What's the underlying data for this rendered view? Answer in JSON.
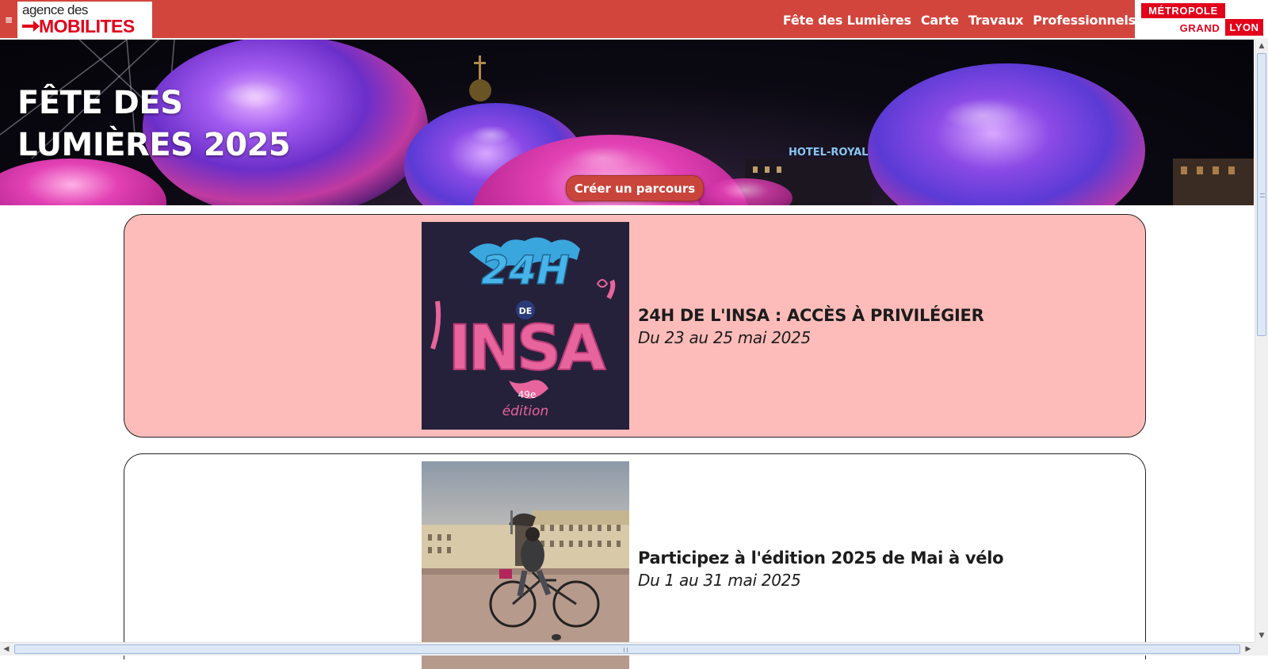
{
  "header": {
    "menu_glyph": "≡",
    "logo": {
      "line1": "agence des",
      "line2": "MOBILITES"
    },
    "nav": [
      {
        "label": "Fête des Lumières"
      },
      {
        "label": "Carte"
      },
      {
        "label": "Travaux"
      },
      {
        "label": "Professionnels"
      }
    ],
    "partner_logo": {
      "top": "MÉTROPOLE",
      "grand": "GRAND",
      "lyon": "LYON"
    }
  },
  "hero": {
    "title": "FÊTE DES LUMIÈRES 2025",
    "button_label": "Créer un parcours"
  },
  "events": [
    {
      "title": "24H DE L'INSA : ACCÈS À PRIVILÉGIER",
      "date": "Du 23 au 25 mai 2025",
      "image_text": {
        "top": "24H",
        "de": "DE",
        "main": "INSA",
        "edition_num": "49e",
        "edition": "édition"
      }
    },
    {
      "title": "Participez à l'édition 2025 de Mai à vélo",
      "date": "Du 1 au 31 mai 2025"
    }
  ],
  "colors": {
    "brand_red": "#d2453d",
    "logo_red": "#e2001a",
    "card_highlight": "#fdbcb9",
    "button": "#c9453b"
  },
  "icons": {
    "menu": "hamburger-icon",
    "scroll_up": "arrow-up-icon",
    "scroll_down": "arrow-down-icon",
    "scroll_left": "arrow-left-icon",
    "scroll_right": "arrow-right-icon"
  }
}
